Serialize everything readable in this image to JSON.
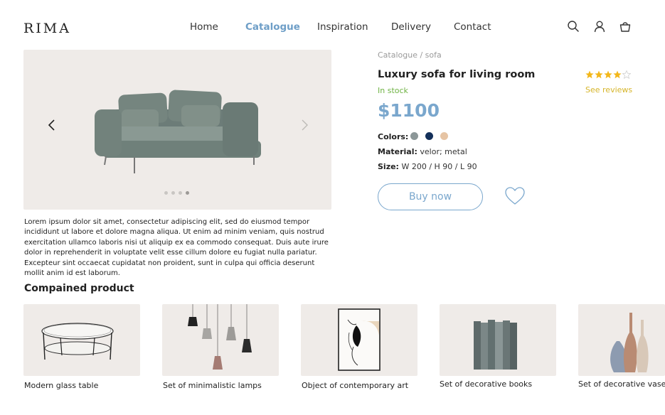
{
  "brand": {
    "logo": "RIMA"
  },
  "nav": {
    "items": [
      "Home",
      "Catalogue",
      "Inspiration",
      "Delivery",
      "Contact"
    ],
    "active": "Catalogue"
  },
  "header_icons": [
    "search-icon",
    "user-icon",
    "cart-icon"
  ],
  "gallery": {
    "slides": 4,
    "active_slide": 4
  },
  "description": "Lorem ipsum dolor sit amet, consectetur adipiscing elit, sed do eiusmod tempor incididunt ut labore et dolore magna aliqua. Ut enim ad minim veniam, quis nostrud exercitation ullamco laboris nisi ut aliquip ex ea commodo consequat. Duis aute irure dolor in reprehenderit in voluptate velit esse cillum dolore eu fugiat nulla pariatur. Excepteur sint occaecat cupidatat non proident, sunt in culpa qui officia deserunt mollit anim id est laborum.",
  "product": {
    "breadcrumb": "Catalogue / sofa",
    "title": "Luxury sofa for living room",
    "stock": "In stock",
    "rating": 4,
    "rating_max": 5,
    "reviews_link": "See reviews",
    "price": "$1100",
    "colors_label": "Colors:",
    "colors": [
      "#8c9798",
      "#14305a",
      "#e6c4a4"
    ],
    "material_label": "Material:",
    "material": "velor; metal",
    "size_label": "Size:",
    "size": "W 200 / H 90 / L 90",
    "buy_label": "Buy now"
  },
  "related": {
    "title": "Compained product",
    "items": [
      "Modern glass table",
      "Set of minimalistic lamps",
      "Object of contemporary art",
      "Set of decorative books",
      "Set of decorative vases"
    ]
  },
  "theme": {
    "accent": "#7aa7cd",
    "stock_green": "#6fb344",
    "star_gold": "#f3b71a",
    "card_bg": "#efebe8"
  }
}
